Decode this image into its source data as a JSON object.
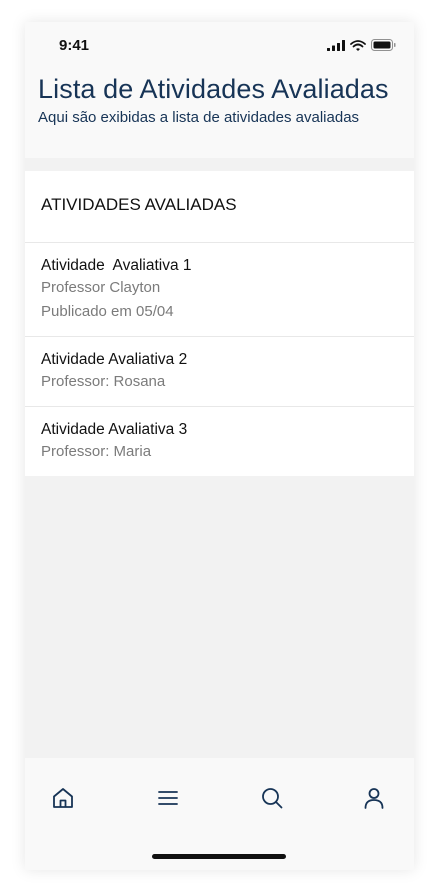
{
  "status": {
    "time": "9:41"
  },
  "header": {
    "title": "Lista de Atividades Avaliadas",
    "subtitle": "Aqui são exibidas a lista de atividades avaliadas"
  },
  "section": {
    "title": "ATIVIDADES AVALIADAS"
  },
  "activities": [
    {
      "title": "Atividade  Avaliativa 1",
      "lines": [
        "Professor Clayton",
        "Publicado em 05/04"
      ]
    },
    {
      "title": "Atividade Avaliativa 2",
      "lines": [
        "Professor: Rosana"
      ]
    },
    {
      "title": "Atividade Avaliativa 3",
      "lines": [
        "Professor: Maria"
      ]
    }
  ],
  "tabs": [
    {
      "icon": "home-icon"
    },
    {
      "icon": "menu-icon"
    },
    {
      "icon": "search-icon"
    },
    {
      "icon": "user-icon"
    }
  ],
  "colors": {
    "title": "#173456",
    "icon": "#173456",
    "background": "#f2f2f2"
  }
}
